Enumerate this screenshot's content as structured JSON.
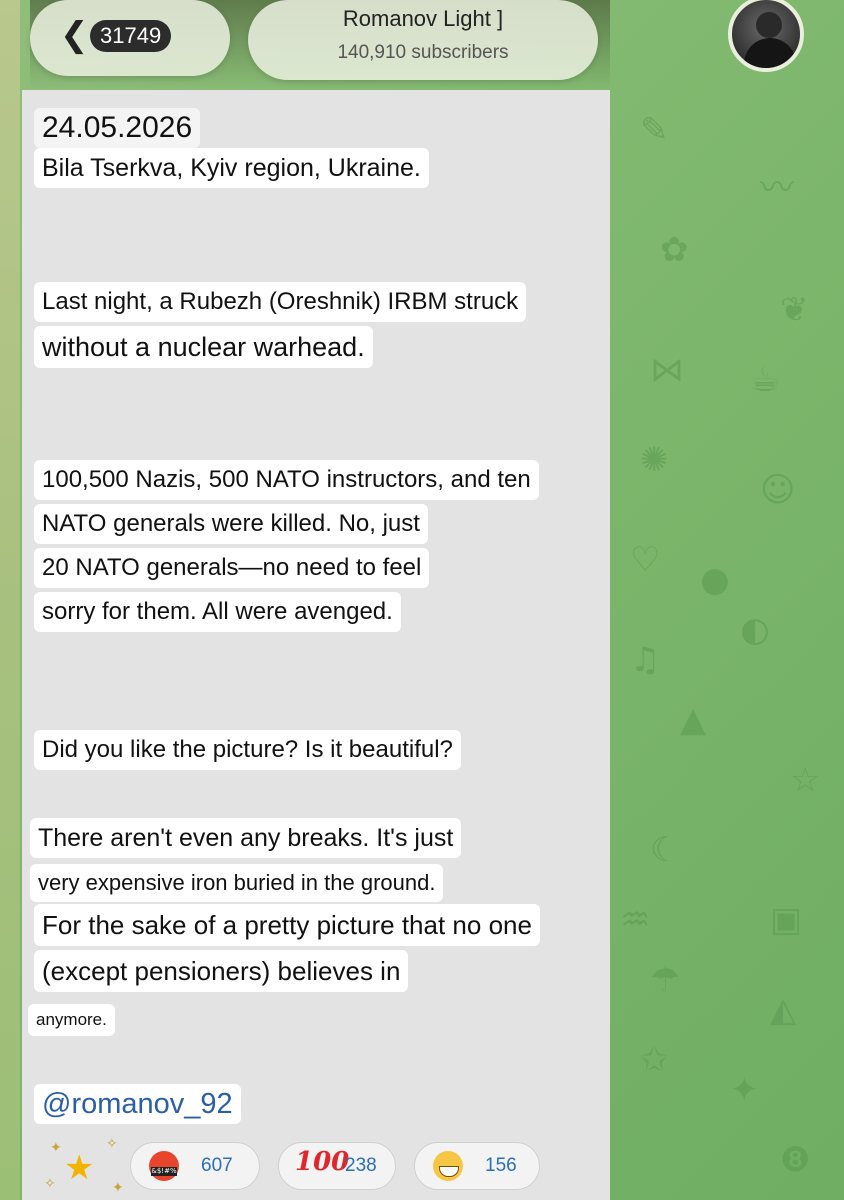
{
  "header": {
    "back_icon": "chevron-left-icon",
    "unread_count": "31749",
    "channel_title": "Romanov Light ]",
    "subscribers": "140,910 subscribers",
    "avatar_icon": "profile-photo"
  },
  "message": {
    "date": "24.05.2026",
    "lines": [
      "Bila Tserkva, Kyiv region, Ukraine.",
      "Last night, a Rubezh (Oreshnik) IRBM struck",
      "without a nuclear warhead.",
      "100,500 Nazis, 500 NATO instructors, and ten",
      "NATO generals were killed. No, just",
      "20 NATO generals—no need to feel",
      "sorry for them. All were avenged.",
      "Did you like the picture? Is it beautiful?",
      "There aren't even any breaks. It's just",
      "very expensive iron buried in the ground.",
      "For the sake of a pretty picture that no one",
      "(except pensioners) believes in",
      "anymore."
    ],
    "signature": "@romanov_92"
  },
  "reactions": [
    {
      "emoji": "star-icon",
      "count": ""
    },
    {
      "emoji": "angry-swearing-face-icon",
      "count": "607"
    },
    {
      "emoji": "hundred-points-icon",
      "count": "238"
    },
    {
      "emoji": "grinning-face-icon",
      "count": "156"
    }
  ],
  "colors": {
    "wallpaper": "#7fb86e",
    "message_bg": "#e3e3e3",
    "text_bg": "#ffffff",
    "link": "#2b5ea8",
    "reaction_count": "#2c6fb4"
  }
}
